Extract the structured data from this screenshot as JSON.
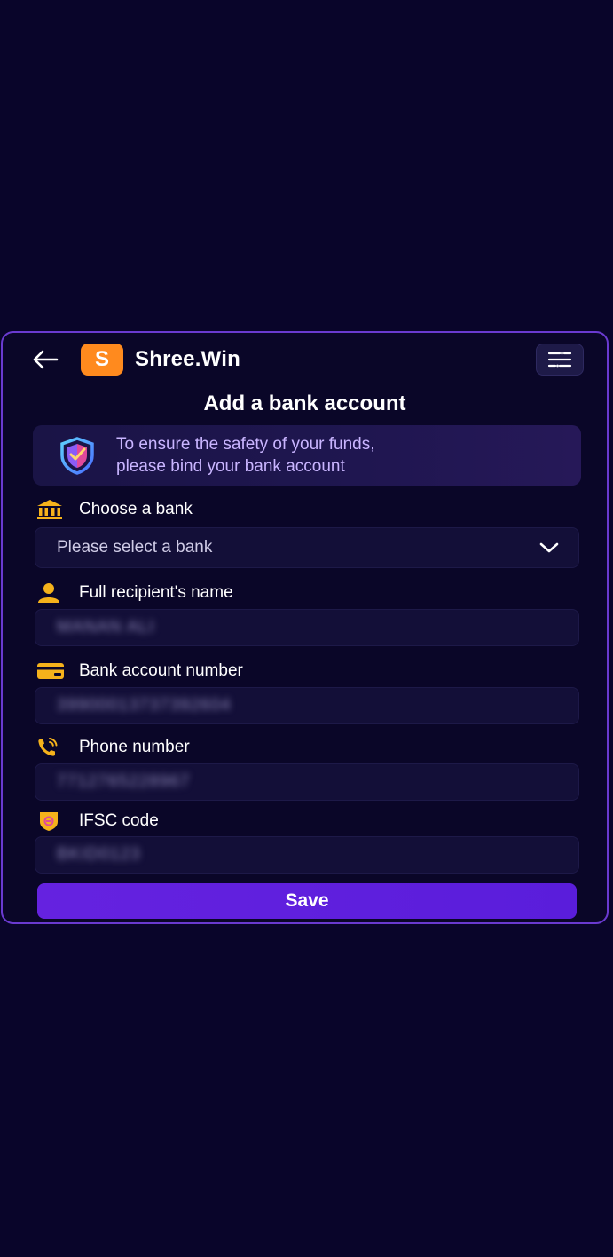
{
  "header": {
    "logo_letter": "S",
    "brand": "Shree.Win",
    "back_icon": "arrow-left-icon",
    "menu_icon": "menu-lines-icon"
  },
  "page": {
    "title": "Add a bank account"
  },
  "notice": {
    "line1": "To ensure the safety of your funds,",
    "line2": "please bind your bank account",
    "icon": "shield-icon"
  },
  "fields": {
    "bank": {
      "label": "Choose a bank",
      "placeholder": "Please select a bank",
      "icon": "bank-icon"
    },
    "name": {
      "label": "Full recipient's name",
      "value": "MANAN ALI",
      "icon": "user-icon"
    },
    "account": {
      "label": "Bank account number",
      "value": "39900013737392604",
      "icon": "card-icon"
    },
    "phone": {
      "label": "Phone number",
      "value": "7712765228967",
      "icon": "phone-icon"
    },
    "ifsc": {
      "label": "IFSC code",
      "value": "BKID0123",
      "icon": "badge-icon"
    }
  },
  "actions": {
    "save_label": "Save"
  },
  "colors": {
    "background": "#09052a",
    "panel_border": "#6a3ad0",
    "accent": "#5a1ddb",
    "icon_gold": "#f5b21b",
    "logo_orange": "#ff8a1e",
    "notice_text": "#c9b5ff"
  }
}
